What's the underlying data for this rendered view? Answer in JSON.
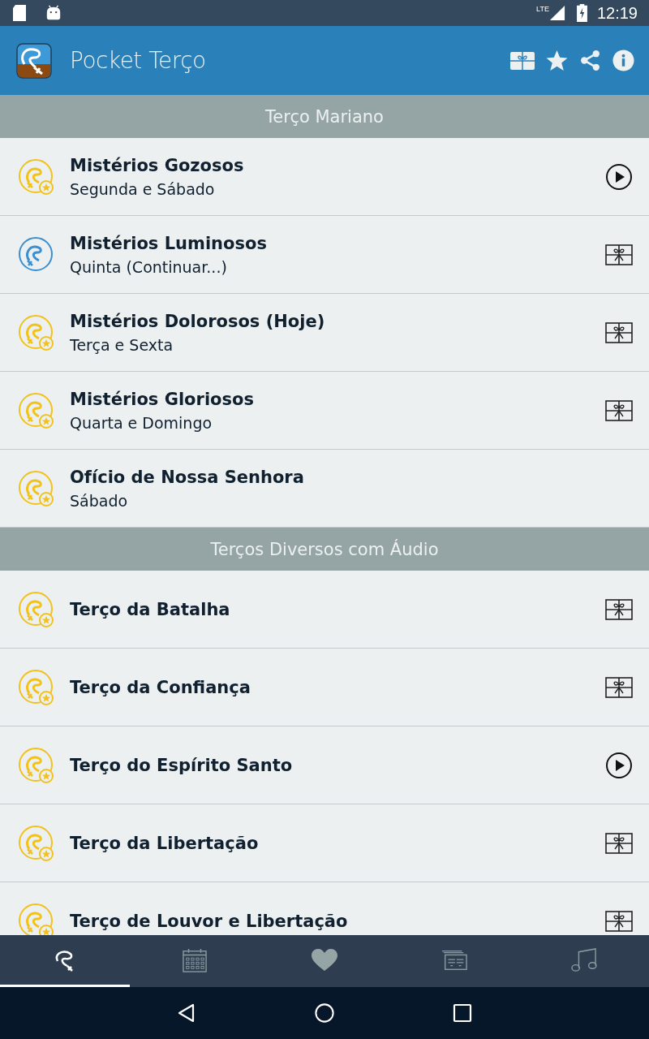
{
  "status_bar": {
    "network": "LTE",
    "time": "12:19"
  },
  "app_bar": {
    "title": "Pocket Terço"
  },
  "sections": [
    {
      "title": "Terço Mariano",
      "items": [
        {
          "title": "Mistérios Gozosos",
          "subtitle": "Segunda e Sábado",
          "icon": {
            "kind": "starred"
          },
          "action": {
            "kind": "play"
          }
        },
        {
          "title": "Mistérios Luminosos",
          "subtitle": "Quinta (Continuar...)",
          "icon": {
            "kind": "current"
          },
          "action": {
            "kind": "gift"
          }
        },
        {
          "title": "Mistérios Dolorosos (Hoje)",
          "subtitle": "Terça e Sexta",
          "icon": {
            "kind": "starred"
          },
          "action": {
            "kind": "gift"
          }
        },
        {
          "title": "Mistérios Gloriosos",
          "subtitle": "Quarta e Domingo",
          "icon": {
            "kind": "starred"
          },
          "action": {
            "kind": "gift"
          }
        },
        {
          "title": "Ofício de Nossa Senhora",
          "subtitle": "Sábado",
          "icon": {
            "kind": "starred"
          }
        }
      ]
    },
    {
      "title": "Terços Diversos com Áudio",
      "items": [
        {
          "title": "Terço da Batalha",
          "icon": {
            "kind": "starred"
          },
          "action": {
            "kind": "gift"
          }
        },
        {
          "title": "Terço da Confiança",
          "icon": {
            "kind": "starred"
          },
          "action": {
            "kind": "gift"
          }
        },
        {
          "title": "Terço do Espírito Santo",
          "icon": {
            "kind": "starred"
          },
          "action": {
            "kind": "play"
          }
        },
        {
          "title": "Terço da Libertação",
          "icon": {
            "kind": "starred"
          },
          "action": {
            "kind": "gift"
          }
        },
        {
          "title": "Terço de Louvor e Libertação",
          "icon": {
            "kind": "starred"
          },
          "action": {
            "kind": "gift"
          }
        }
      ]
    }
  ],
  "bottom_tabs": [
    {
      "kind": "rosary",
      "selected": true
    },
    {
      "kind": "calendar",
      "selected": false
    },
    {
      "kind": "heart",
      "selected": false
    },
    {
      "kind": "cards",
      "selected": false
    },
    {
      "kind": "music",
      "selected": false
    }
  ]
}
